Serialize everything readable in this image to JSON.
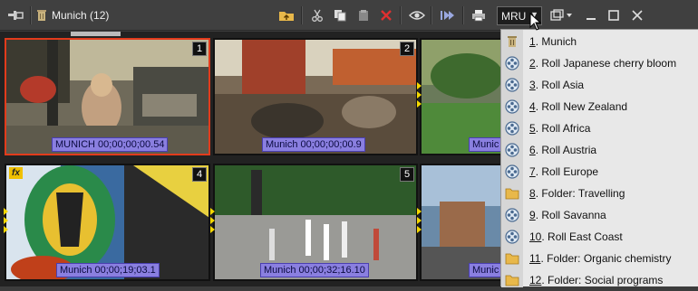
{
  "toolbar": {
    "title": "Munich (12)",
    "mru_label": "MRU",
    "icons": [
      "pin-icon",
      "trash-icon",
      "folder-up-icon",
      "cut-icon",
      "copy-icon",
      "paste-icon",
      "delete-icon",
      "eye-icon",
      "play-icon",
      "print-icon",
      "window-menu-icon",
      "minimize-icon",
      "maximize-icon",
      "close-icon"
    ]
  },
  "clips": [
    {
      "num": "1",
      "timecode": "MUNICH 00;00;00;00.54",
      "selected": true
    },
    {
      "num": "2",
      "timecode": "Munich 00;00;00;00.9"
    },
    {
      "num": "",
      "timecode": "Munic"
    },
    {
      "num": "4",
      "timecode": "Munich 00;00;19;03.1",
      "fx": "fx"
    },
    {
      "num": "5",
      "timecode": "Munich 00;00;32;16.10"
    },
    {
      "num": "",
      "timecode": "Munic"
    }
  ],
  "mru_menu": {
    "items": [
      {
        "label": "1. Munich",
        "icon": "bin-icon"
      },
      {
        "label": "2. Roll  Japanese cherry bloom",
        "icon": "reel-icon"
      },
      {
        "label": "3. Roll  Asia",
        "icon": "reel-icon"
      },
      {
        "label": "4. Roll  New Zealand",
        "icon": "reel-icon"
      },
      {
        "label": "5. Roll  Africa",
        "icon": "reel-icon"
      },
      {
        "label": "6. Roll  Austria",
        "icon": "reel-icon"
      },
      {
        "label": "7. Roll  Europe",
        "icon": "reel-icon"
      },
      {
        "label": "8. Folder: Travelling",
        "icon": "folder-icon"
      },
      {
        "label": "9. Roll  Savanna",
        "icon": "reel-icon"
      },
      {
        "label": "10. Roll  East Coast",
        "icon": "reel-icon"
      },
      {
        "label": "11. Folder: Organic chemistry",
        "icon": "folder-icon"
      },
      {
        "label": "12. Folder: Social programs",
        "icon": "folder-icon"
      }
    ]
  },
  "colors": {
    "selected_border": "#e23b1c",
    "timecode_bg": "#8a7fe0",
    "marker": "#f5d800"
  }
}
